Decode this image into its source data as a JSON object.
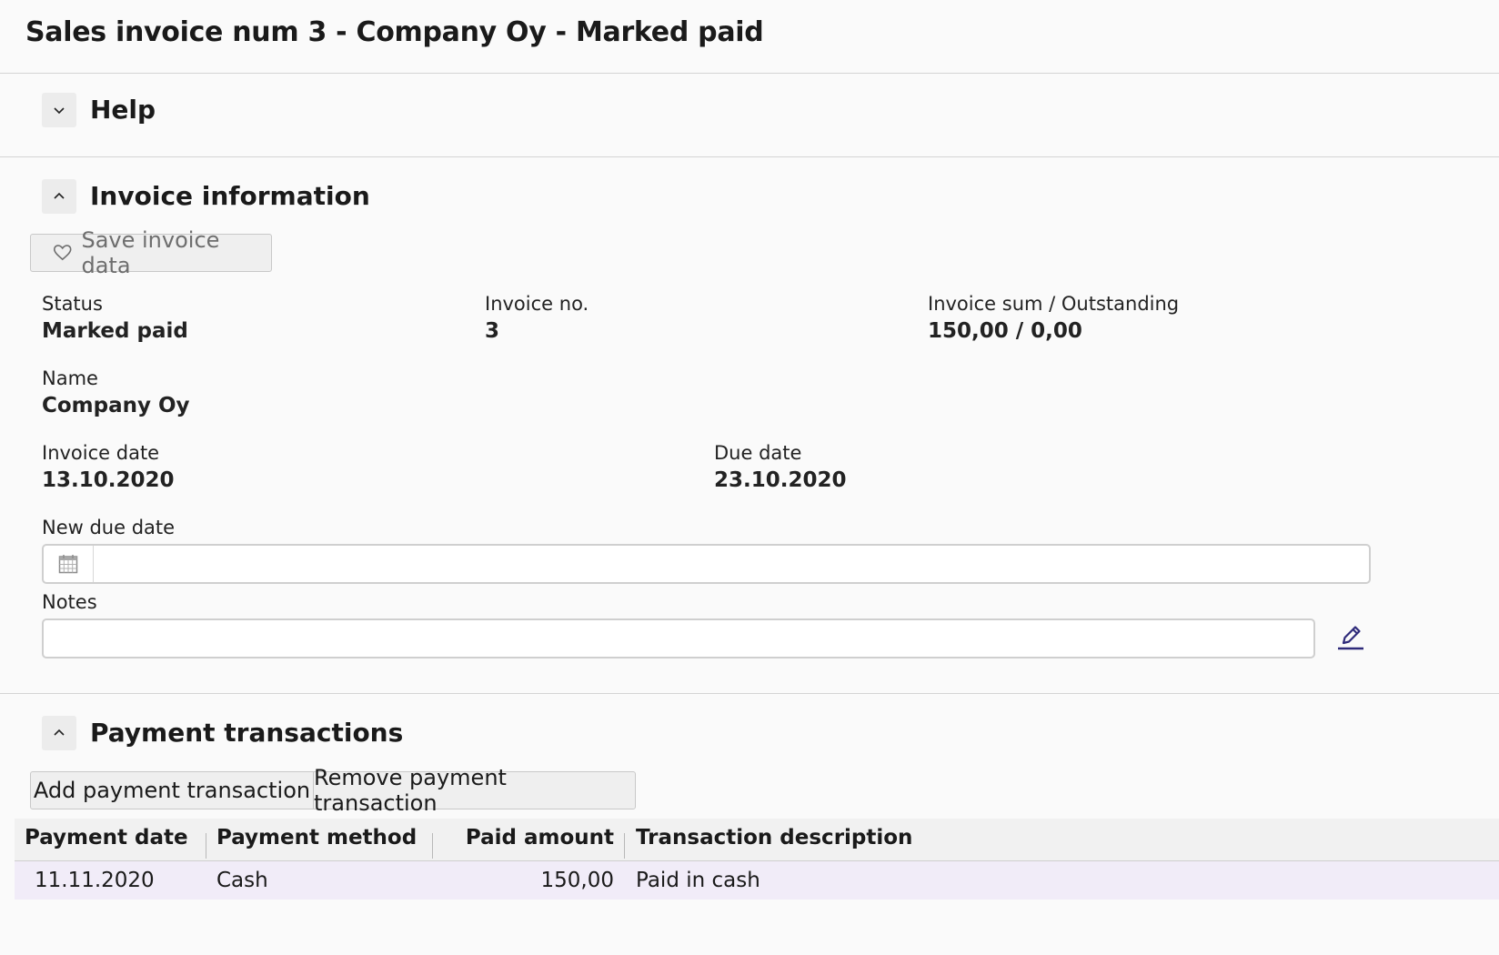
{
  "page": {
    "title": "Sales invoice num 3 - Company Oy - Marked paid"
  },
  "sections": {
    "help": {
      "title": "Help",
      "expanded": false
    },
    "invoice_info": {
      "title": "Invoice information",
      "expanded": true
    },
    "payments": {
      "title": "Payment transactions",
      "expanded": true
    }
  },
  "invoice": {
    "save_label": "Save invoice data",
    "status_label": "Status",
    "status_value": "Marked paid",
    "invoice_no_label": "Invoice no.",
    "invoice_no_value": "3",
    "sum_label": "Invoice sum / Outstanding",
    "sum_value": "150,00 / 0,00",
    "name_label": "Name",
    "name_value": "Company Oy",
    "invoice_date_label": "Invoice date",
    "invoice_date_value": "13.10.2020",
    "due_date_label": "Due date",
    "due_date_value": "23.10.2020",
    "new_due_date_label": "New due date",
    "new_due_date_value": "",
    "notes_label": "Notes",
    "notes_value": ""
  },
  "payments": {
    "add_label": "Add payment transaction",
    "remove_label": "Remove payment transaction",
    "columns": [
      "Payment date",
      "Payment method",
      "Paid amount",
      "Transaction description"
    ],
    "rows": [
      [
        "11.11.2020",
        "Cash",
        "150,00",
        "Paid in cash"
      ]
    ]
  },
  "icons": {
    "help_toggle": "chevron-down-icon",
    "section_toggle": "chevron-up-icon",
    "save": "heart-icon",
    "calendar": "calendar-icon",
    "edit": "pencil-icon"
  },
  "colors": {
    "accent": "#2e2a7a",
    "selected_row": "#f1ecf8",
    "background": "#fafafa"
  }
}
